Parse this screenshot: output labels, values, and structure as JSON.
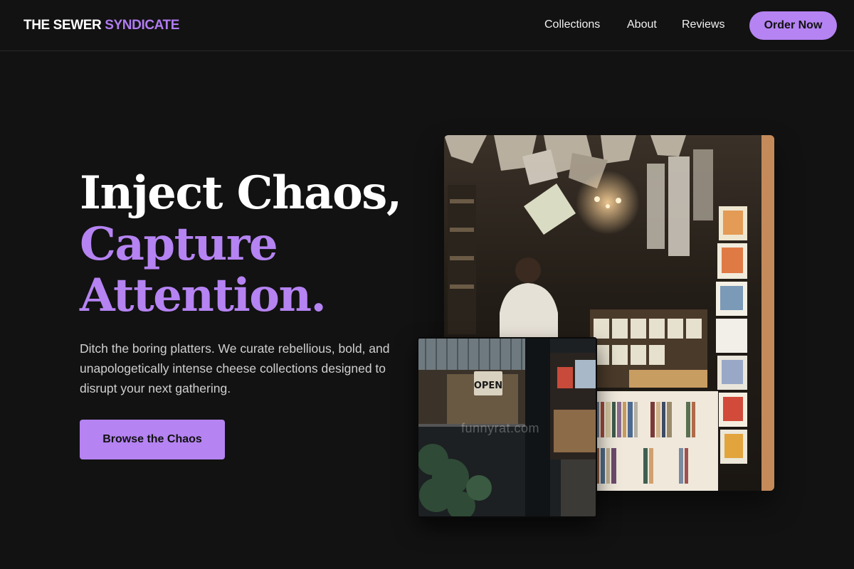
{
  "nav": {
    "logo_main": "THE SEWER",
    "logo_accent": "SYNDICATE",
    "links": [
      "Collections",
      "About",
      "Reviews"
    ],
    "cta": "Order Now"
  },
  "hero": {
    "headline_line1": "Inject Chaos,",
    "headline_line2": "Capture",
    "headline_line3": "Attention.",
    "subtext": "Ditch the boring platters. We curate rebellious, bold, and unapologetically intense cheese collections designed to disrupt your next gathering.",
    "cta": "Browse the Chaos"
  },
  "images": {
    "main": "bookshop-interior-photo",
    "secondary": "shopfront-open-sign-photo",
    "sign_text": "OPEN",
    "watermark": "funnyrat.com"
  },
  "colors": {
    "background": "#121212",
    "accent": "#b583f2",
    "text": "#ffffff",
    "muted_text": "#d0d0d0"
  }
}
